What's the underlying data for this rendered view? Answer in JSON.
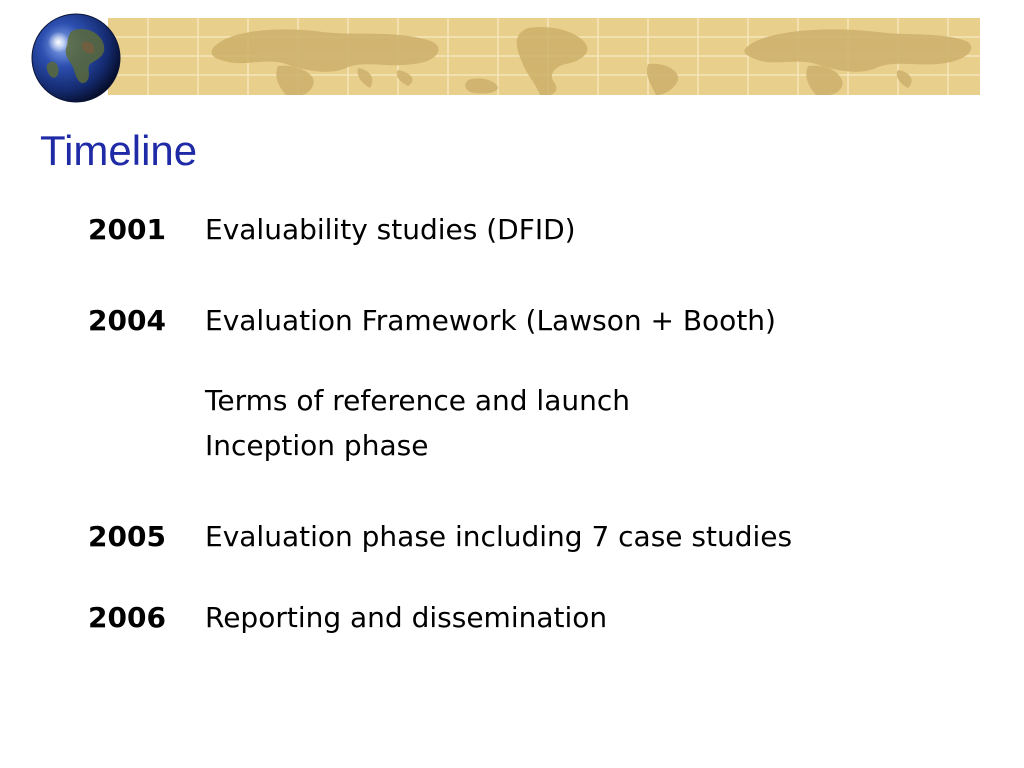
{
  "slide": {
    "title": "Timeline",
    "colors": {
      "title": "#1f2aa6",
      "header_band": "#e9cf8c",
      "map_land": "#cdb06a",
      "grid_lines": "#f6e6b9",
      "text": "#000000"
    },
    "icons": {
      "globe": "globe-icon",
      "world_map": "world-map-icon"
    }
  },
  "timeline": [
    {
      "year": "2001",
      "items": [
        "Evaluability studies (DFID)"
      ]
    },
    {
      "year": "2004",
      "items": [
        "Evaluation Framework (Lawson + Booth)"
      ]
    },
    {
      "year": "",
      "items": [
        "Terms of reference and launch",
        "Inception phase"
      ]
    },
    {
      "year": "2005",
      "items": [
        "Evaluation phase including 7 case studies"
      ]
    },
    {
      "year": "2006",
      "items": [
        "Reporting and dissemination"
      ]
    }
  ]
}
